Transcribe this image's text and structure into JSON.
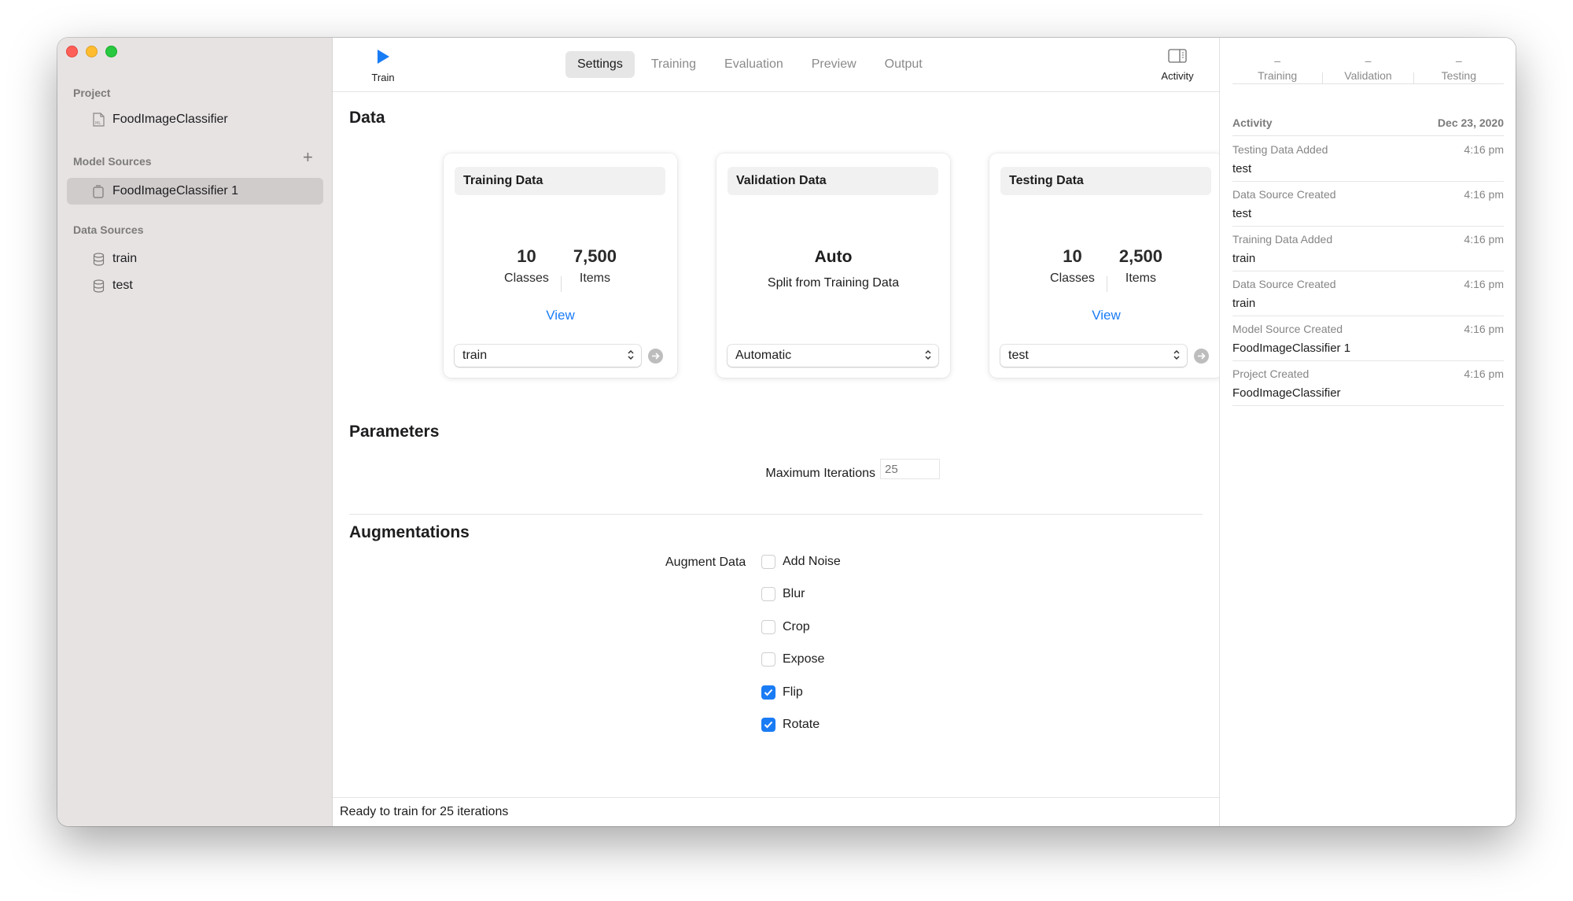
{
  "window": {
    "controls": [
      "close",
      "minimize",
      "zoom"
    ]
  },
  "sidebar": {
    "project_section": "Project",
    "project_item": {
      "label": "FoodImageClassifier",
      "icon": "ml-file-icon"
    },
    "model_sources_section": "Model Sources",
    "add_label": "+",
    "model_sources": [
      {
        "label": "FoodImageClassifier 1",
        "icon": "model-source-icon",
        "selected": true
      }
    ],
    "data_sources_section": "Data Sources",
    "data_sources": [
      {
        "label": "train",
        "icon": "database-icon"
      },
      {
        "label": "test",
        "icon": "database-icon"
      }
    ]
  },
  "toolbar": {
    "train_label": "Train",
    "activity_label": "Activity",
    "tabs": [
      {
        "label": "Settings",
        "active": true
      },
      {
        "label": "Training",
        "active": false
      },
      {
        "label": "Evaluation",
        "active": false
      },
      {
        "label": "Preview",
        "active": false
      },
      {
        "label": "Output",
        "active": false
      }
    ]
  },
  "data_section": {
    "heading": "Data",
    "training": {
      "title": "Training Data",
      "classes_value": "10",
      "classes_label": "Classes",
      "items_value": "7,500",
      "items_label": "Items",
      "view_label": "View",
      "selected_source": "train"
    },
    "validation": {
      "title": "Validation Data",
      "mode": "Auto",
      "description": "Split from Training Data",
      "selected_option": "Automatic"
    },
    "testing": {
      "title": "Testing Data",
      "classes_value": "10",
      "classes_label": "Classes",
      "items_value": "2,500",
      "items_label": "Items",
      "view_label": "View",
      "selected_source": "test"
    }
  },
  "parameters": {
    "heading": "Parameters",
    "max_iterations_label": "Maximum Iterations",
    "max_iterations_placeholder": "25"
  },
  "augmentations": {
    "heading": "Augmentations",
    "label": "Augment Data",
    "options": [
      {
        "label": "Add Noise",
        "checked": false
      },
      {
        "label": "Blur",
        "checked": false
      },
      {
        "label": "Crop",
        "checked": false
      },
      {
        "label": "Expose",
        "checked": false
      },
      {
        "label": "Flip",
        "checked": true
      },
      {
        "label": "Rotate",
        "checked": true
      }
    ]
  },
  "status_bar": {
    "text": "Ready to train for 25 iterations"
  },
  "inspector": {
    "summary": [
      {
        "value": "–",
        "label": "Training"
      },
      {
        "value": "–",
        "label": "Validation"
      },
      {
        "value": "–",
        "label": "Testing"
      }
    ],
    "activity_heading": "Activity",
    "activity_date": "Dec 23, 2020",
    "activity": [
      {
        "title": "Testing Data Added",
        "time": "4:16 pm",
        "subject": "test"
      },
      {
        "title": "Data Source Created",
        "time": "4:16 pm",
        "subject": "test"
      },
      {
        "title": "Training Data Added",
        "time": "4:16 pm",
        "subject": "train"
      },
      {
        "title": "Data Source Created",
        "time": "4:16 pm",
        "subject": "train"
      },
      {
        "title": "Model Source Created",
        "time": "4:16 pm",
        "subject": "FoodImageClassifier 1"
      },
      {
        "title": "Project Created",
        "time": "4:16 pm",
        "subject": "FoodImageClassifier"
      }
    ]
  },
  "colors": {
    "accent": "#1a7cf5",
    "sidebar_bg": "#e7e3e3",
    "sidebar_selected": "#d1cccc",
    "close": "#ff5f57",
    "minimize": "#febc2e",
    "zoom": "#28c840"
  }
}
